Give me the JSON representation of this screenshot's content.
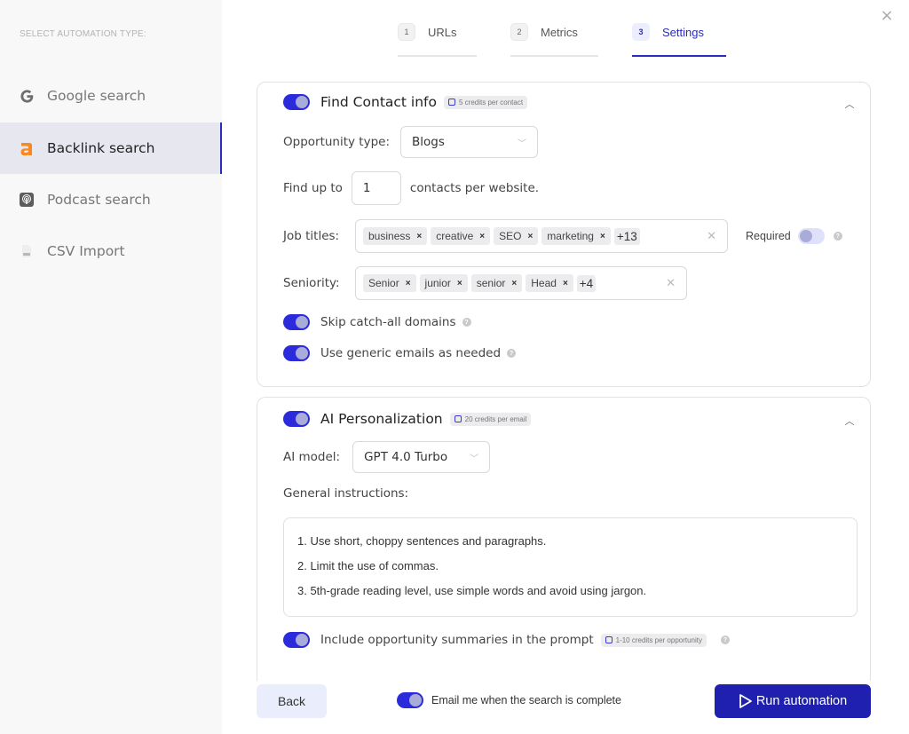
{
  "sidebar": {
    "heading": "SELECT AUTOMATION TYPE:",
    "items": [
      {
        "label": "Google search",
        "icon": "google-icon",
        "active": false
      },
      {
        "label": "Backlink search",
        "icon": "ahrefs-icon",
        "active": true
      },
      {
        "label": "Podcast search",
        "icon": "podcast-icon",
        "active": false
      },
      {
        "label": "CSV Import",
        "icon": "csv-file-icon",
        "active": false
      }
    ]
  },
  "steps": [
    {
      "number": "1",
      "label": "URLs",
      "active": false
    },
    {
      "number": "2",
      "label": "Metrics",
      "active": false
    },
    {
      "number": "3",
      "label": "Settings",
      "active": true
    }
  ],
  "close_label": "×",
  "contact_card": {
    "title": "Find Contact info",
    "enabled": true,
    "credits": "5 credits per contact",
    "opportunity_type_label": "Opportunity type:",
    "opportunity_type_value": "Blogs",
    "find_up_to_label": "Find up to",
    "find_up_to_value": "1",
    "find_up_to_suffix": "contacts per website.",
    "job_titles_label": "Job titles:",
    "job_titles": [
      "business",
      "creative",
      "SEO",
      "marketing"
    ],
    "job_titles_more": "+13",
    "required_label": "Required",
    "required_enabled": false,
    "seniority_label": "Seniority:",
    "seniority": [
      "Senior",
      "junior",
      "senior",
      "Head"
    ],
    "seniority_more": "+4",
    "skip_catch_all_label": "Skip catch-all domains",
    "skip_catch_all_enabled": true,
    "generic_emails_label": "Use generic emails as needed",
    "generic_emails_enabled": true
  },
  "ai_card": {
    "title": "AI Personalization",
    "enabled": true,
    "credits": "20 credits per email",
    "model_label": "AI model:",
    "model_value": "GPT 4.0 Turbo",
    "instructions_label": "General instructions:",
    "instructions": [
      "1. Use short, choppy sentences and paragraphs.",
      "2. Limit the use of commas.",
      "3. 5th-grade reading level, use simple words and avoid using jargon."
    ],
    "summaries_label": "Include opportunity summaries in the prompt",
    "summaries_enabled": true,
    "summaries_credits": "1-10 credits per opportunity"
  },
  "footer": {
    "back_label": "Back",
    "email_label": "Email me when the search is complete",
    "email_enabled": true,
    "run_label": "Run automation"
  },
  "colors": {
    "accent": "#2b2bdb",
    "primary_button": "#2020b0",
    "backlink_icon": "#f7891f"
  }
}
